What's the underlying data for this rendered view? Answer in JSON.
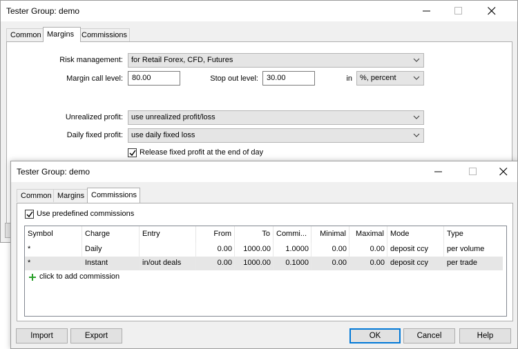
{
  "back_window": {
    "title": "Tester Group: demo",
    "tabs": [
      {
        "label": "Common"
      },
      {
        "label": "Margins"
      },
      {
        "label": "Commissions"
      }
    ],
    "risk_management": {
      "label": "Risk management:",
      "value": "for Retail Forex, CFD, Futures"
    },
    "margin_call": {
      "label": "Margin call level:",
      "value": "80.00"
    },
    "stop_out": {
      "label": "Stop out level:",
      "value": "30.00"
    },
    "in_label": "in",
    "unit": {
      "value": "%, percent"
    },
    "unrealized_profit": {
      "label": "Unrealized profit:",
      "value": "use unrealized profit/loss"
    },
    "daily_fixed_profit": {
      "label": "Daily fixed profit:",
      "value": "use daily fixed loss"
    },
    "release_fixed_profit": {
      "label": "Release fixed profit at the end of day",
      "checked": true
    }
  },
  "front_window": {
    "title": "Tester Group: demo",
    "tabs": [
      {
        "label": "Common"
      },
      {
        "label": "Margins"
      },
      {
        "label": "Commissions"
      }
    ],
    "use_predefined": {
      "label": "Use predefined commissions",
      "checked": true
    },
    "columns": [
      {
        "label": "Symbol"
      },
      {
        "label": "Charge"
      },
      {
        "label": "Entry"
      },
      {
        "label": "From"
      },
      {
        "label": "To"
      },
      {
        "label": "Commi..."
      },
      {
        "label": "Minimal"
      },
      {
        "label": "Maximal"
      },
      {
        "label": "Mode"
      },
      {
        "label": "Type"
      }
    ],
    "rows": [
      [
        "*",
        "Daily",
        "",
        "0.00",
        "1000.00",
        "1.0000",
        "0.00",
        "0.00",
        "deposit ccy",
        "per volume"
      ],
      [
        "*",
        "Instant",
        "in/out deals",
        "0.00",
        "1000.00",
        "0.1000",
        "0.00",
        "0.00",
        "deposit ccy",
        "per trade"
      ]
    ],
    "add_commission": {
      "label": "click to add commission",
      "icon": "plus-icon",
      "color": "#2aa02a"
    },
    "buttons": {
      "import": "Import",
      "export": "Export",
      "ok": "OK",
      "cancel": "Cancel",
      "help": "Help"
    }
  },
  "colors": {
    "accent": "#0078d7",
    "selected_row": "#e6e6e6"
  }
}
